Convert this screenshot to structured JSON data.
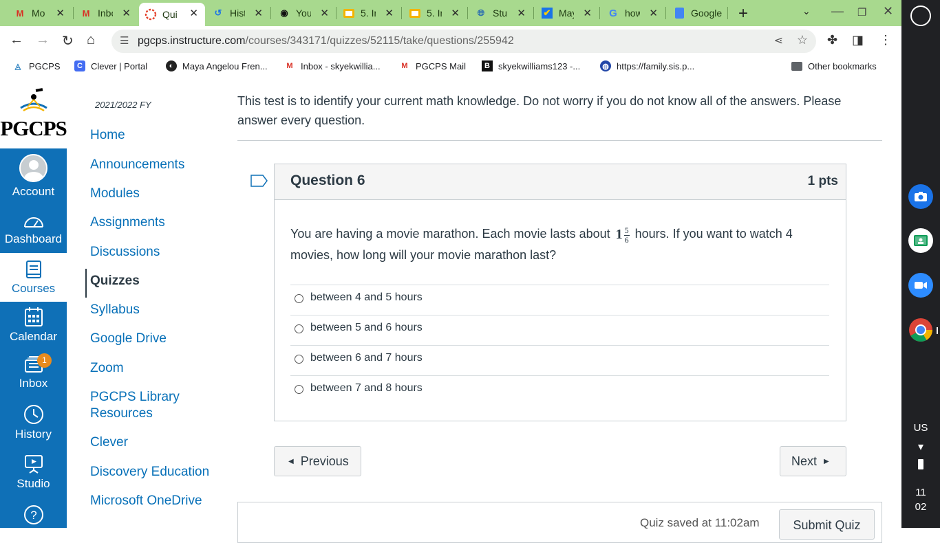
{
  "browser": {
    "tabs": [
      {
        "title": "Mo",
        "favicon": "gmail-icon"
      },
      {
        "title": "Inbo",
        "favicon": "gmail-icon"
      },
      {
        "title": "Qui",
        "favicon": "canvas-icon",
        "active": true
      },
      {
        "title": "Hist",
        "favicon": "history-icon"
      },
      {
        "title": "You",
        "favicon": "youtube-icon"
      },
      {
        "title": "5. Ir",
        "favicon": "slides-icon"
      },
      {
        "title": "5. Ir",
        "favicon": "slides-icon"
      },
      {
        "title": "Stu",
        "favicon": "globe-icon"
      },
      {
        "title": "May",
        "favicon": "check-icon"
      },
      {
        "title": "how",
        "favicon": "google-icon"
      },
      {
        "title": "Google",
        "favicon": "docs-icon"
      }
    ],
    "url_domain": "pgcps.instructure.com",
    "url_path": "/courses/343171/quizzes/52115/take/questions/255942",
    "bookmarks": [
      {
        "label": "PGCPS"
      },
      {
        "label": "Clever | Portal"
      },
      {
        "label": "Maya Angelou Fren..."
      },
      {
        "label": "Inbox - skyekwillia..."
      },
      {
        "label": "PGCPS Mail"
      },
      {
        "label": "skyekwilliams123 -..."
      },
      {
        "label": "https://family.sis.p..."
      },
      {
        "label": "Other bookmarks"
      }
    ]
  },
  "shelf": {
    "keyboard_layout": "US",
    "time_hour": "11",
    "time_min": "02"
  },
  "logo": {
    "text": "PGCPS"
  },
  "global_nav": {
    "items": [
      {
        "label": "Account"
      },
      {
        "label": "Dashboard"
      },
      {
        "label": "Courses"
      },
      {
        "label": "Calendar"
      },
      {
        "label": "Inbox",
        "badge": "1"
      },
      {
        "label": "History"
      },
      {
        "label": "Studio"
      }
    ]
  },
  "course_nav": {
    "term": "2021/2022 FY",
    "links": [
      {
        "label": "Home"
      },
      {
        "label": "Announcements"
      },
      {
        "label": "Modules"
      },
      {
        "label": "Assignments"
      },
      {
        "label": "Discussions"
      },
      {
        "label": "Quizzes",
        "active": true
      },
      {
        "label": "Syllabus"
      },
      {
        "label": "Google Drive"
      },
      {
        "label": "Zoom"
      },
      {
        "label": "PGCPS Library Resources"
      },
      {
        "label": "Clever"
      },
      {
        "label": "Discovery Education"
      },
      {
        "label": "Microsoft OneDrive"
      }
    ]
  },
  "quiz": {
    "intro": "This test is to identify your current math knowledge.  Do not worry if you do not know all of the answers. Please answer every question.",
    "question_title": "Question 6",
    "points": "1 pts",
    "text_before": "You are having a movie marathon. Each movie lasts about ",
    "fraction_whole": "1",
    "fraction_num": "5",
    "fraction_den": "6",
    "text_after": " hours. If you want to watch 4 movies, how long will your movie marathon last?",
    "answers": [
      {
        "label": "between 4 and 5 hours"
      },
      {
        "label": "between 5 and 6 hours"
      },
      {
        "label": "between 6 and 7 hours"
      },
      {
        "label": "between 7 and 8 hours"
      }
    ],
    "prev_label": "Previous",
    "next_label": "Next",
    "saved_text": "Quiz saved at 11:02am",
    "submit_label": "Submit Quiz"
  }
}
